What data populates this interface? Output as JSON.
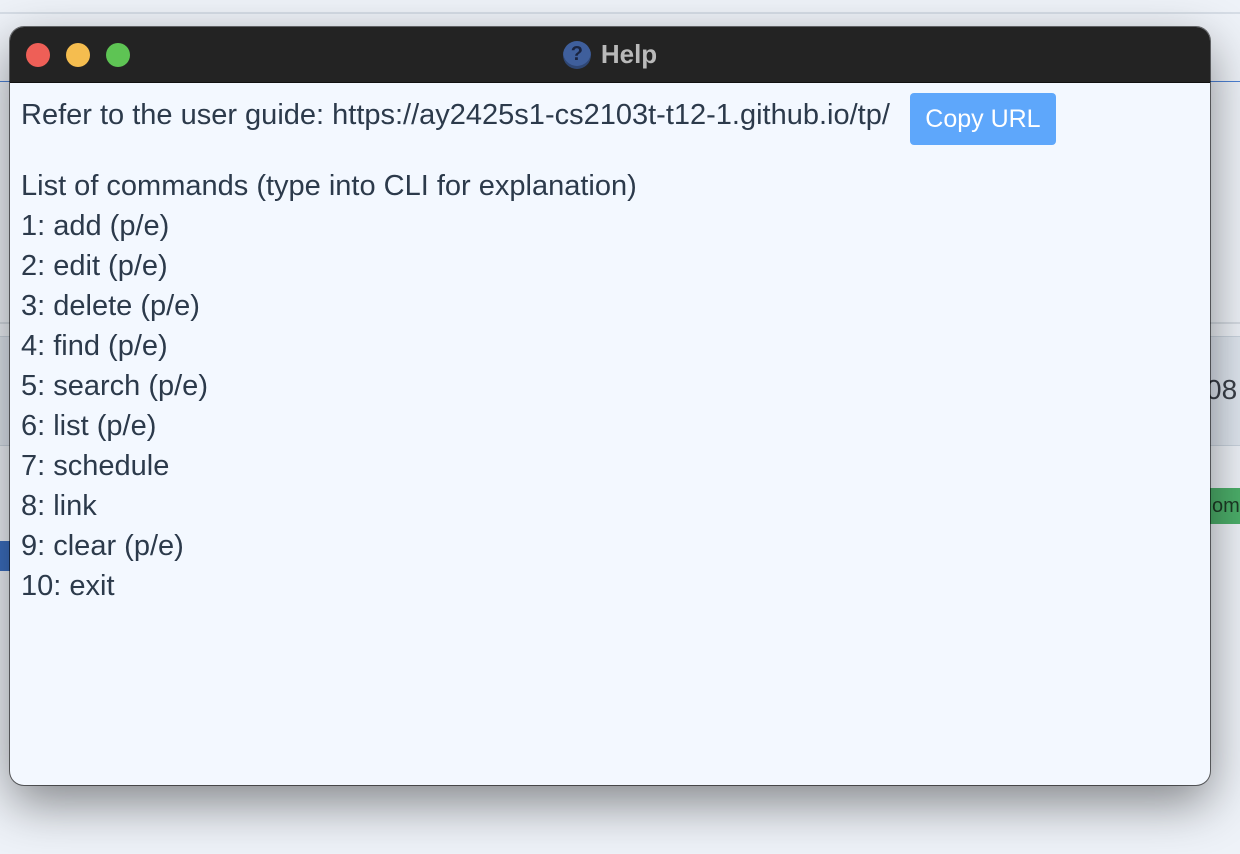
{
  "window": {
    "title": "Help",
    "controls": [
      "close",
      "minimize",
      "zoom"
    ],
    "title_icon": "question-icon"
  },
  "help": {
    "guide_text": "Refer to the user guide: https://ay2425s1-cs2103t-t12-1.github.io/tp/",
    "copy_button_label": "Copy URL",
    "commands_heading": "List of commands (type into CLI for explanation)",
    "commands": [
      "1: add (p/e)",
      "2: edit (p/e)",
      "3: delete (p/e)",
      "4: find (p/e)",
      "5: search (p/e)",
      "6: list (p/e)",
      "7: schedule",
      "8: link",
      "9: clear (p/e)",
      "10: exit"
    ]
  },
  "background": {
    "fragment_right": "08",
    "fragment_badge": "omp"
  },
  "colors": {
    "titlebar": "#232323",
    "content_bg": "#f3f8ff",
    "text": "#2c3a4b",
    "button": "#5ea7fb",
    "close": "#ee5f57",
    "minimize": "#f5bd4f",
    "zoom": "#5ec454"
  }
}
